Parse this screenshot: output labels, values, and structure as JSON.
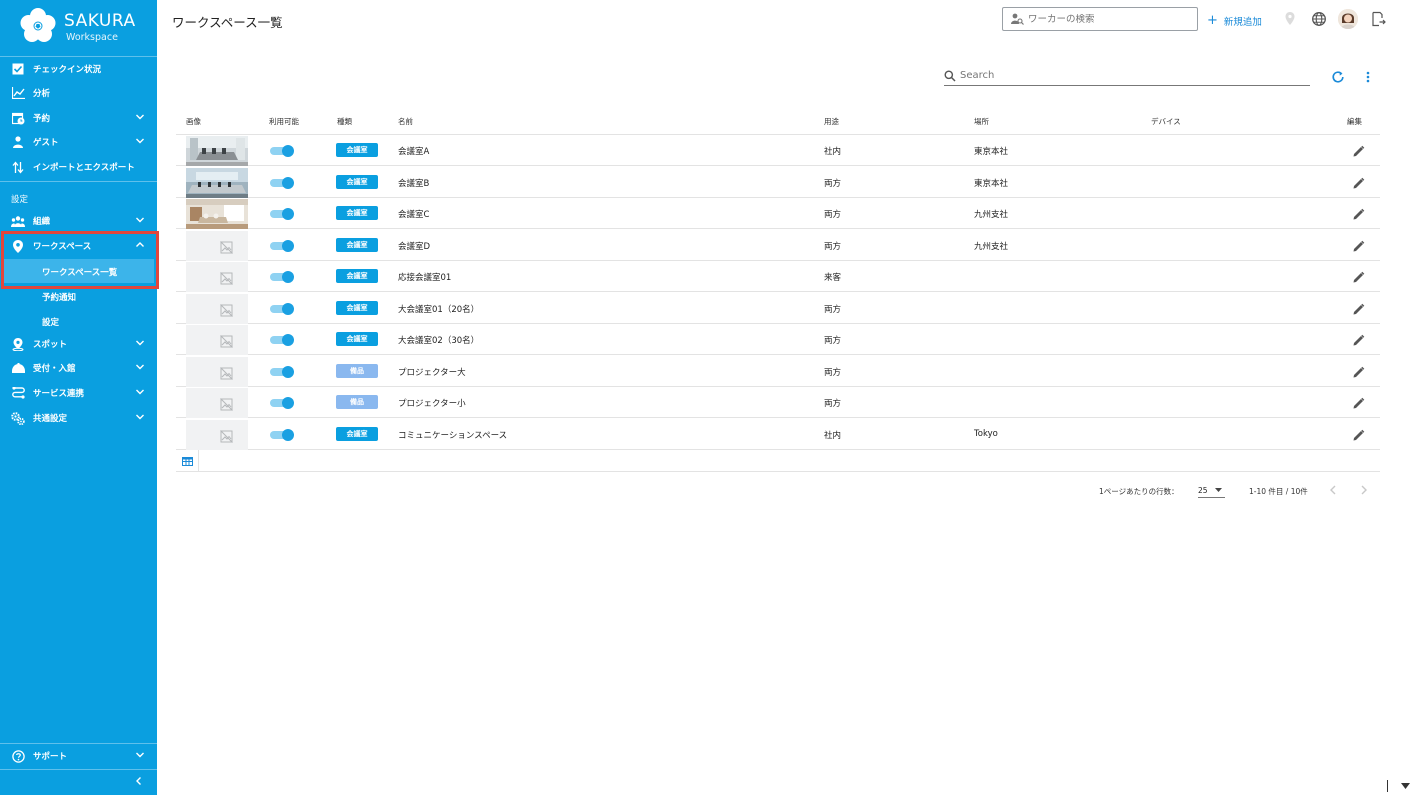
{
  "app": {
    "brand_title": "SAKURA",
    "brand_sub": "Workspace"
  },
  "sidebar": {
    "items": [
      {
        "label": "チェックイン状況",
        "icon": "checkbox-icon"
      },
      {
        "label": "分析",
        "icon": "chart-line-icon"
      },
      {
        "label": "予約",
        "icon": "calendar-clock-icon"
      },
      {
        "label": "ゲスト",
        "icon": "guest-icon"
      },
      {
        "label": "インポートとエクスポート",
        "icon": "import-export-icon"
      }
    ],
    "settings_label": "設定",
    "settings_items": [
      {
        "label": "組織",
        "icon": "people-icon"
      },
      {
        "label": "ワークスペース",
        "icon": "location-pin-icon"
      }
    ],
    "workspace_sub": [
      "ワークスペース一覧",
      "予約通知",
      "設定"
    ],
    "more_items": [
      {
        "label": "スポット",
        "icon": "location-pin-icon"
      },
      {
        "label": "受付・入館",
        "icon": "reception-icon"
      },
      {
        "label": "サービス連携",
        "icon": "link-icon"
      },
      {
        "label": "共通設定",
        "icon": "gears-icon"
      }
    ],
    "support_label": "サポート"
  },
  "header": {
    "title": "ワークスペース一覧",
    "worker_search_placeholder": "ワーカーの検索",
    "add_new_label": "新規追加"
  },
  "toolbar": {
    "search_placeholder": "Search"
  },
  "table": {
    "columns": [
      "画像",
      "利用可能",
      "種類",
      "名前",
      "用途",
      "場所",
      "デバイス",
      "編集"
    ],
    "rows": [
      {
        "image": "photo-1",
        "available": true,
        "type": "会議室",
        "name": "会議室A",
        "usage": "社内",
        "place": "東京本社",
        "device": ""
      },
      {
        "image": "photo-2",
        "available": true,
        "type": "会議室",
        "name": "会議室B",
        "usage": "両方",
        "place": "東京本社",
        "device": ""
      },
      {
        "image": "photo-3",
        "available": true,
        "type": "会議室",
        "name": "会議室C",
        "usage": "両方",
        "place": "九州支社",
        "device": ""
      },
      {
        "image": "",
        "available": true,
        "type": "会議室",
        "name": "会議室D",
        "usage": "両方",
        "place": "九州支社",
        "device": ""
      },
      {
        "image": "",
        "available": true,
        "type": "会議室",
        "name": "応接会議室01",
        "usage": "来客",
        "place": "",
        "device": ""
      },
      {
        "image": "",
        "available": true,
        "type": "会議室",
        "name": "大会議室01（20名）",
        "usage": "両方",
        "place": "",
        "device": ""
      },
      {
        "image": "",
        "available": true,
        "type": "会議室",
        "name": "大会議室02（30名）",
        "usage": "両方",
        "place": "",
        "device": ""
      },
      {
        "image": "",
        "available": true,
        "type": "備品",
        "name": "プロジェクター大",
        "usage": "両方",
        "place": "",
        "device": ""
      },
      {
        "image": "",
        "available": true,
        "type": "備品",
        "name": "プロジェクター小",
        "usage": "両方",
        "place": "",
        "device": ""
      },
      {
        "image": "",
        "available": true,
        "type": "会議室",
        "name": "コミュニケーションスペース",
        "usage": "社内",
        "place": "Tokyo",
        "device": ""
      }
    ]
  },
  "pagination": {
    "rows_per_page_label": "1ページあたりの行数：",
    "rows_per_page": "25",
    "range_label": "1-10 件目 / 10件"
  },
  "colors": {
    "sidebar_bg": "#0a9fe0",
    "badge_room": "#0a9fe0",
    "badge_equipment": "#8ab8ef",
    "accent": "#1a8ad8",
    "highlight": "#e2463c"
  }
}
